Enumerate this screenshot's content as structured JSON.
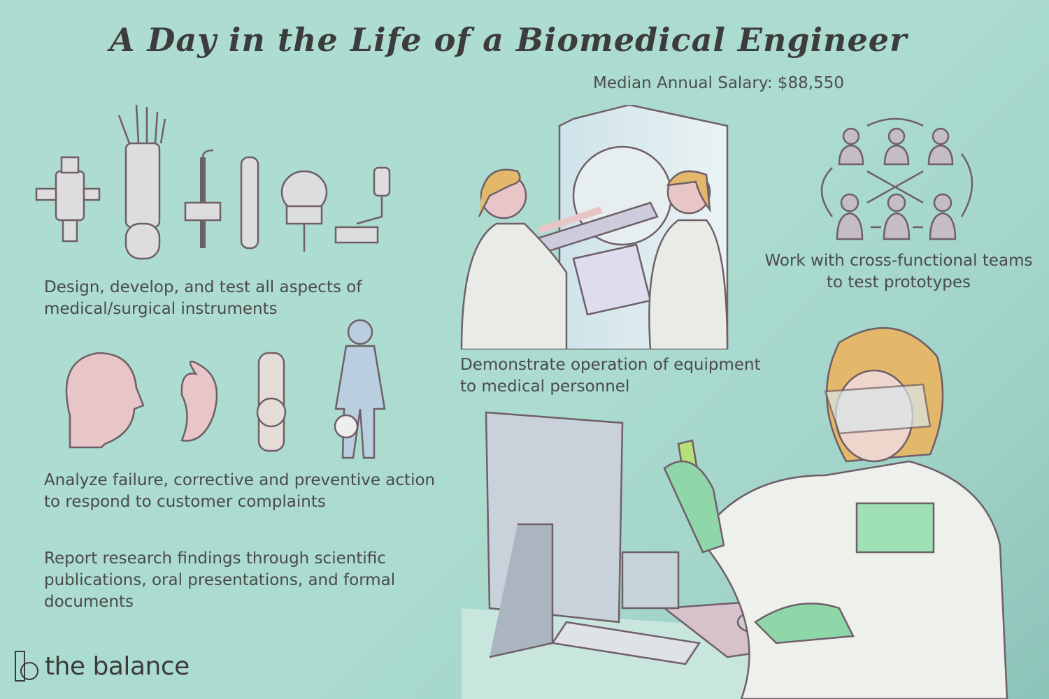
{
  "title": "A Day in the Life of a Biomedical Engineer",
  "salary": "Median Annual Salary: $88,550",
  "duties": {
    "design": "Design, develop, and test all aspects of medical/surgical instruments",
    "demonstrate": "Demonstrate operation of equipment to medical personnel",
    "teams": "Work with cross-functional teams to test prototypes",
    "analyze": "Analyze failure, corrective and preventive action to respond to customer complaints",
    "report": "Report research findings through scientific publications, oral presentations, and formal documents"
  },
  "brand": {
    "name": "the balance"
  },
  "colors": {
    "background": "#acdcd0",
    "text": "#4a4a4a",
    "line": "#6f5f68",
    "skin": "#e8c6c8",
    "hair": "#e3b86a",
    "glove": "#8fd6a8"
  }
}
